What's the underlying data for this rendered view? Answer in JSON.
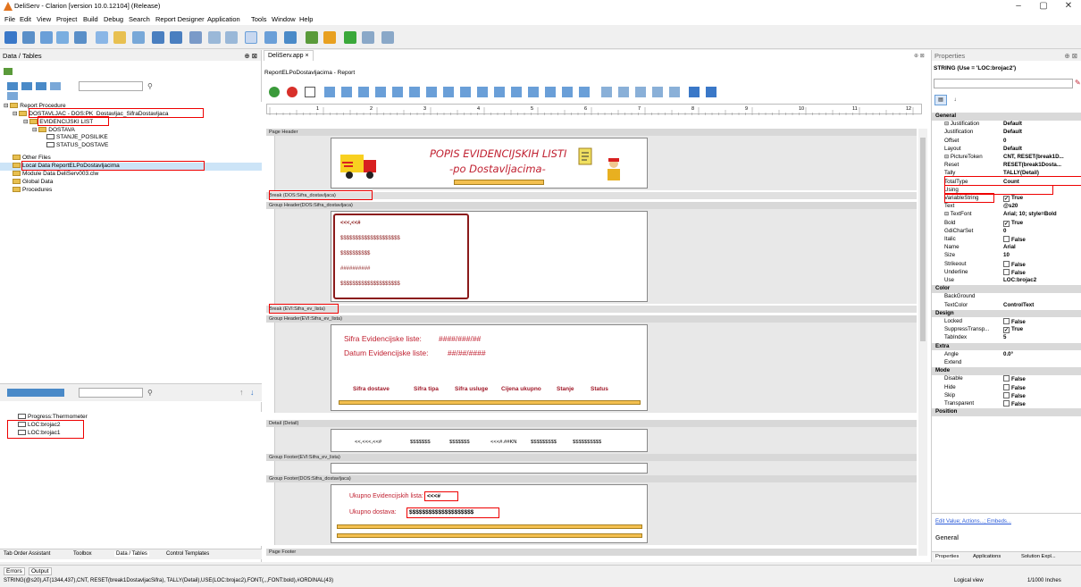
{
  "titlebar": {
    "title": "DeliServ - Clarion [version 10.0.12104] (Release)",
    "min": "–",
    "max": "▢",
    "close": "✕"
  },
  "menu": [
    "File",
    "Edit",
    "View",
    "Project",
    "Build",
    "Debug",
    "Search",
    "Report Designer",
    "Application",
    "Tools",
    "Window",
    "Help"
  ],
  "left_panel": {
    "title": "Data / Tables",
    "pin": "⊕ ⊠",
    "tree": [
      {
        "label": "Report Procedure",
        "type": "folder"
      },
      {
        "label": "DOSTAVLJAC - DOS:PK_Dostavljac_SifraDostavljaca",
        "type": "folder"
      },
      {
        "label": "EVIDENCIJSKI LIST",
        "type": "folder"
      },
      {
        "label": "DOSTAVA",
        "type": "folder"
      },
      {
        "label": "STANJE_POSILIKE",
        "type": "table"
      },
      {
        "label": "STATUS_DOSTAVE",
        "type": "table"
      },
      {
        "label": "Other Files",
        "type": "folder"
      },
      {
        "label": "Local Data ReportELPoDostavljacima",
        "type": "folder"
      },
      {
        "label": "Module Data DeliServ003.clw",
        "type": "folder"
      },
      {
        "label": "Global Data",
        "type": "folder"
      },
      {
        "label": "Procedures",
        "type": "folder"
      }
    ],
    "local_tree": [
      {
        "label": "Progress:Thermometer"
      },
      {
        "label": "LOC:brojac2"
      },
      {
        "label": "LOC:brojac1"
      }
    ],
    "bottom_tabs": [
      "Tab Order Assistant",
      "Toolbox",
      "Data / Tables",
      "Control Templates"
    ]
  },
  "doc": {
    "tab": "DeliServ.app",
    "tab_close": "×",
    "breadcrumb": "ReportELPoDostavljacima - Report",
    "ruler_nums": [
      "1",
      "2",
      "3",
      "4",
      "5",
      "6",
      "7",
      "8",
      "9",
      "10",
      "11",
      "12"
    ],
    "bands": {
      "page_header": "Page Header",
      "break1": "Break (DOS:Sifra_dostavljaca)",
      "group_header1": "Group Header(DOS:Sifra_dostavljaca)",
      "break2": "Break (EVI:Sifra_ev_lista)",
      "group_header2": "Group Header(EVI:Sifra_ev_lista)",
      "detail": "Detail (Detail)",
      "group_footer2": "Group Footer(EVI:Sifra_ev_lista)",
      "group_footer1": "Group Footer(DOS:Sifra_dostavljaca)",
      "page_footer": "Page Footer"
    },
    "report_title": "POPIS EVIDENCIJSKIH LISTI",
    "report_subtitle": "-po Dostavljacima-",
    "group1_fields": [
      "<<<,<<#",
      "$$$$$$$$$$$$$$$$$$$$",
      "$$$$$$$$$$",
      "##########",
      "$$$$$$$$$$$$$$$$$$$$"
    ],
    "group2": {
      "sifra_label": "Sifra Evidencijske liste:",
      "sifra_val": "####/###/##",
      "datum_label": "Datum Evidencijske liste:",
      "datum_val": "##/##/####",
      "headers": [
        "Sifra dostave",
        "Sifra tipa",
        "Sifra usluge",
        "Cijena ukupno",
        "Stanje",
        "Status"
      ]
    },
    "detail_fields": [
      "<<,<<<,<<#",
      "$$$$$$$",
      "$$$$$$$",
      "<<<#.##KN",
      "$$$$$$$$$",
      "$$$$$$$$$$"
    ],
    "footer": {
      "ukupno_ev_label": "Ukupno Evidencijskih lista:",
      "ukupno_ev_val": "<<<#",
      "ukupno_dost_label": "Ukupno dostava:",
      "ukupno_dost_val": "$$$$$$$$$$$$$$$$$$$$"
    }
  },
  "props": {
    "title": "Properties",
    "pin": "⊕ ⊠",
    "selector": "STRING (Use = 'LOC:brojac2')",
    "rows": [
      {
        "k": "General",
        "cat": true
      },
      {
        "k": "⊟ Justification",
        "v": "Default"
      },
      {
        "k": "Justification",
        "v": "Default"
      },
      {
        "k": "Offset",
        "v": "0"
      },
      {
        "k": "Layout",
        "v": "Default"
      },
      {
        "k": "⊟ PictureToken",
        "v": "CNT, RESET(break1D..."
      },
      {
        "k": "Reset",
        "v": "RESET(break1Dosta..."
      },
      {
        "k": "Tally",
        "v": "TALLY(Detail)"
      },
      {
        "k": "TotalType",
        "v": "Count"
      },
      {
        "k": "Using",
        "v": ""
      },
      {
        "k": "VariableString",
        "v": "True",
        "chk": true
      },
      {
        "k": "Text",
        "v": "@s20"
      },
      {
        "k": "⊟ TextFont",
        "v": "Arial; 10; style=Bold"
      },
      {
        "k": "Bold",
        "v": "True",
        "chk": true
      },
      {
        "k": "GdiCharSet",
        "v": "0"
      },
      {
        "k": "Italic",
        "v": "False",
        "chk": false
      },
      {
        "k": "Name",
        "v": "Arial"
      },
      {
        "k": "Size",
        "v": "10"
      },
      {
        "k": "Strikeout",
        "v": "False",
        "chk": false
      },
      {
        "k": "Underline",
        "v": "False",
        "chk": false
      },
      {
        "k": "Use",
        "v": "LOC:brojac2"
      },
      {
        "k": "Color",
        "cat": true
      },
      {
        "k": "BackGround",
        "v": ""
      },
      {
        "k": "TextColor",
        "v": "ControlText"
      },
      {
        "k": "Design",
        "cat": true
      },
      {
        "k": "Locked",
        "v": "False",
        "chk": false
      },
      {
        "k": "SuppressTransp...",
        "v": "True",
        "chk": true
      },
      {
        "k": "TabIndex",
        "v": "5"
      },
      {
        "k": "Extra",
        "cat": true
      },
      {
        "k": "Angle",
        "v": "0.0°"
      },
      {
        "k": "Extend",
        "v": ""
      },
      {
        "k": "Mode",
        "cat": true
      },
      {
        "k": "Disable",
        "v": "False",
        "chk": false
      },
      {
        "k": "Hide",
        "v": "False",
        "chk": false
      },
      {
        "k": "Skip",
        "v": "False",
        "chk": false
      },
      {
        "k": "Transparent",
        "v": "False",
        "chk": false
      },
      {
        "k": "Position",
        "cat": true
      }
    ],
    "links": "Edit Value; Actions...; Embeds...",
    "desc": "General",
    "bottom_tabs": [
      "Properties",
      "Applications",
      "Solution Expl..."
    ]
  },
  "output_tabs": [
    "Errors",
    "Output"
  ],
  "status": {
    "text": "STRING(@s20),AT(1344,437),CNT, RESET(break1DostavljacSifra), TALLY(Detail),USE(LOC:brojac2),FONT(,,,FONT:bold),#ORDINAL(43)",
    "view": "Logical view",
    "units": "1/1000 Inches"
  }
}
